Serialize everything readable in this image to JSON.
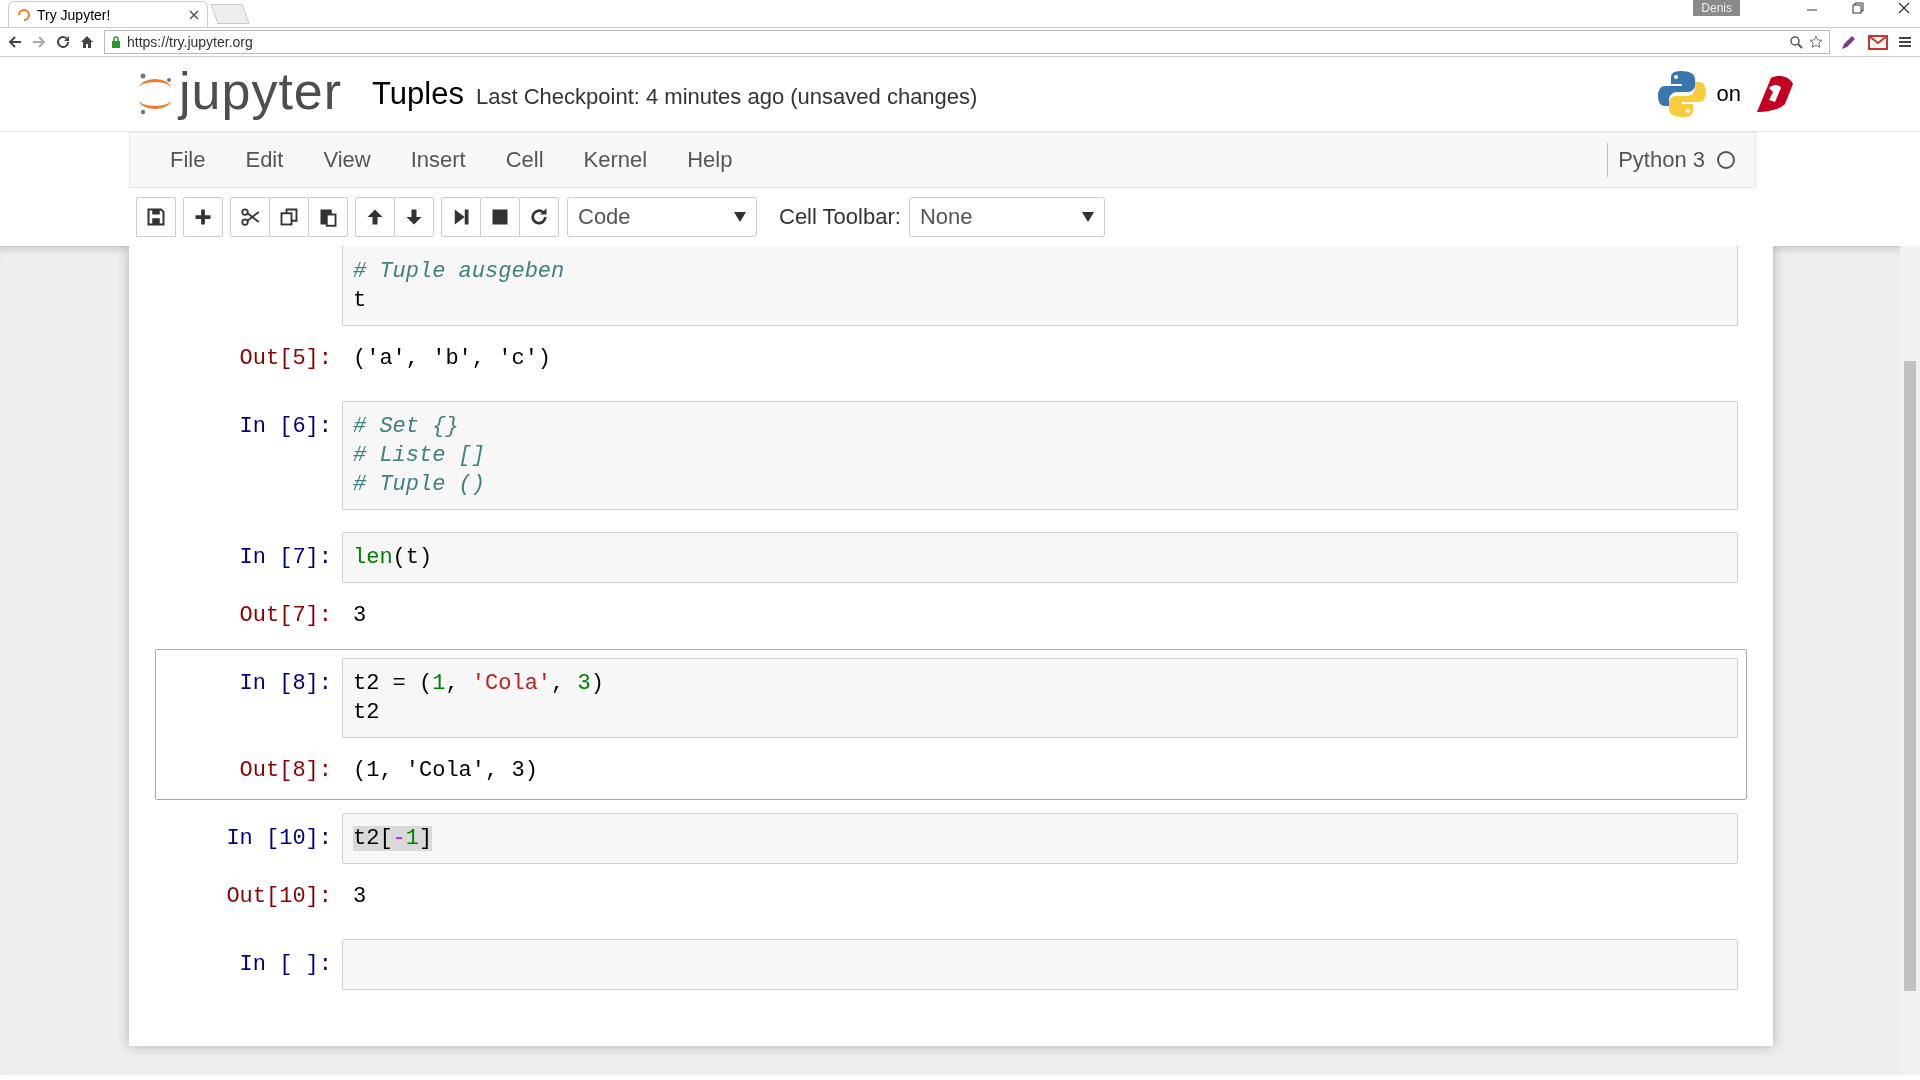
{
  "browser": {
    "tabs": [
      {
        "title": "Try Jupyter!",
        "selected": true
      }
    ],
    "user": "Denis",
    "url": "https://try.jupyter.org"
  },
  "header": {
    "logo_text": "jupyter",
    "notebook_title": "Tuples",
    "checkpoint": "Last Checkpoint: 4 minutes ago (unsaved changes)",
    "host_label": "on"
  },
  "menu": {
    "items": [
      "File",
      "Edit",
      "View",
      "Insert",
      "Cell",
      "Kernel",
      "Help"
    ],
    "kernel": "Python 3",
    "kernel_busy": false
  },
  "toolbar": {
    "cell_type": "Code",
    "cell_toolbar_label": "Cell Toolbar:",
    "cell_toolbar": "None"
  },
  "cells": [
    {
      "selected": false,
      "clipped_top": true,
      "code": [
        [
          {
            "text": "# Tuple ausgeben",
            "kind": "comment"
          }
        ],
        [
          {
            "text": "t",
            "kind": "name"
          }
        ]
      ],
      "output": {
        "prompt": "Out[5]:",
        "lines": [
          "('a', 'b', 'c')"
        ]
      }
    },
    {
      "prompt": "In [6]:",
      "selected": false,
      "code": [
        [
          {
            "text": "# Set {}",
            "kind": "comment"
          }
        ],
        [
          {
            "text": "# Liste []",
            "kind": "comment"
          }
        ],
        [
          {
            "text": "# Tuple ()",
            "kind": "comment"
          }
        ]
      ]
    },
    {
      "prompt": "In [7]:",
      "selected": false,
      "code": [
        [
          {
            "text": "len",
            "kind": "builtin"
          },
          {
            "text": "(t)",
            "kind": "name"
          }
        ]
      ],
      "output": {
        "prompt": "Out[7]:",
        "lines": [
          "3"
        ]
      }
    },
    {
      "prompt": "In [8]:",
      "selected": true,
      "code": [
        [
          {
            "text": "t2 = (",
            "kind": "name"
          },
          {
            "text": "1",
            "kind": "number"
          },
          {
            "text": ", ",
            "kind": "name"
          },
          {
            "text": "'Cola'",
            "kind": "string"
          },
          {
            "text": ", ",
            "kind": "name"
          },
          {
            "text": "3",
            "kind": "number"
          },
          {
            "text": ")",
            "kind": "name"
          }
        ],
        [
          {
            "text": "t2",
            "kind": "name"
          }
        ]
      ],
      "output": {
        "prompt": "Out[8]:",
        "lines": [
          "(1, 'Cola', 3)"
        ]
      }
    },
    {
      "prompt": "In [10]:",
      "selected": false,
      "text_highlighted": true,
      "code": [
        [
          {
            "text": "t2[",
            "kind": "name"
          },
          {
            "text": "-",
            "kind": "operator"
          },
          {
            "text": "1",
            "kind": "number"
          },
          {
            "text": "]",
            "kind": "name"
          }
        ]
      ],
      "output": {
        "prompt": "Out[10]:",
        "lines": [
          "3"
        ]
      }
    },
    {
      "prompt": "In [ ]:",
      "selected": false
    }
  ]
}
